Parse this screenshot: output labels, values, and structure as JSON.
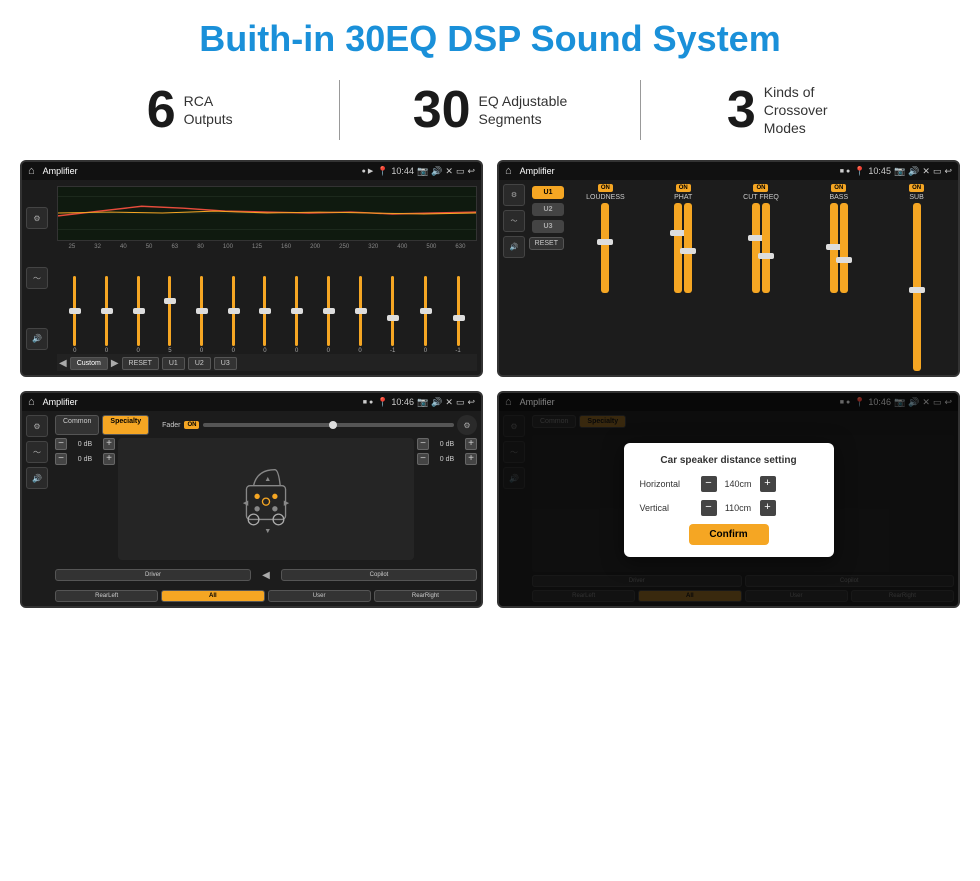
{
  "header": {
    "title": "Buith-in 30EQ DSP Sound System"
  },
  "stats": [
    {
      "number": "6",
      "label": "RCA\nOutputs"
    },
    {
      "number": "30",
      "label": "EQ Adjustable\nSegments"
    },
    {
      "number": "3",
      "label": "Kinds of\nCrossover Modes"
    }
  ],
  "screens": {
    "eq": {
      "appName": "Amplifier",
      "time": "10:44",
      "freqs": [
        "25",
        "32",
        "40",
        "50",
        "63",
        "80",
        "100",
        "125",
        "160",
        "200",
        "250",
        "320",
        "400",
        "500",
        "630"
      ],
      "sliderVals": [
        "0",
        "0",
        "0",
        "5",
        "0",
        "0",
        "0",
        "0",
        "0",
        "0",
        "-1",
        "0",
        "-1"
      ],
      "bottomBtns": [
        "Custom",
        "RESET",
        "U1",
        "U2",
        "U3"
      ]
    },
    "crossover": {
      "appName": "Amplifier",
      "time": "10:45",
      "presets": [
        "U1",
        "U2",
        "U3"
      ],
      "channels": [
        "LOUDNESS",
        "PHAT",
        "CUT FREQ",
        "BASS",
        "SUB"
      ],
      "resetLabel": "RESET"
    },
    "speaker": {
      "appName": "Amplifier",
      "time": "10:46",
      "tabs": [
        "Common",
        "Specialty"
      ],
      "faderLabel": "Fader",
      "faderOn": "ON",
      "volLeft": [
        "0 dB",
        "0 dB"
      ],
      "volRight": [
        "0 dB",
        "0 dB"
      ],
      "footerBtns": [
        "Driver",
        "",
        "Copilot",
        "RearLeft",
        "All",
        "User",
        "RearRight"
      ]
    },
    "dialog": {
      "appName": "Amplifier",
      "time": "10:46",
      "title": "Car speaker distance setting",
      "horizontal": {
        "label": "Horizontal",
        "value": "140cm"
      },
      "vertical": {
        "label": "Vertical",
        "value": "110cm"
      },
      "confirmLabel": "Confirm"
    }
  }
}
